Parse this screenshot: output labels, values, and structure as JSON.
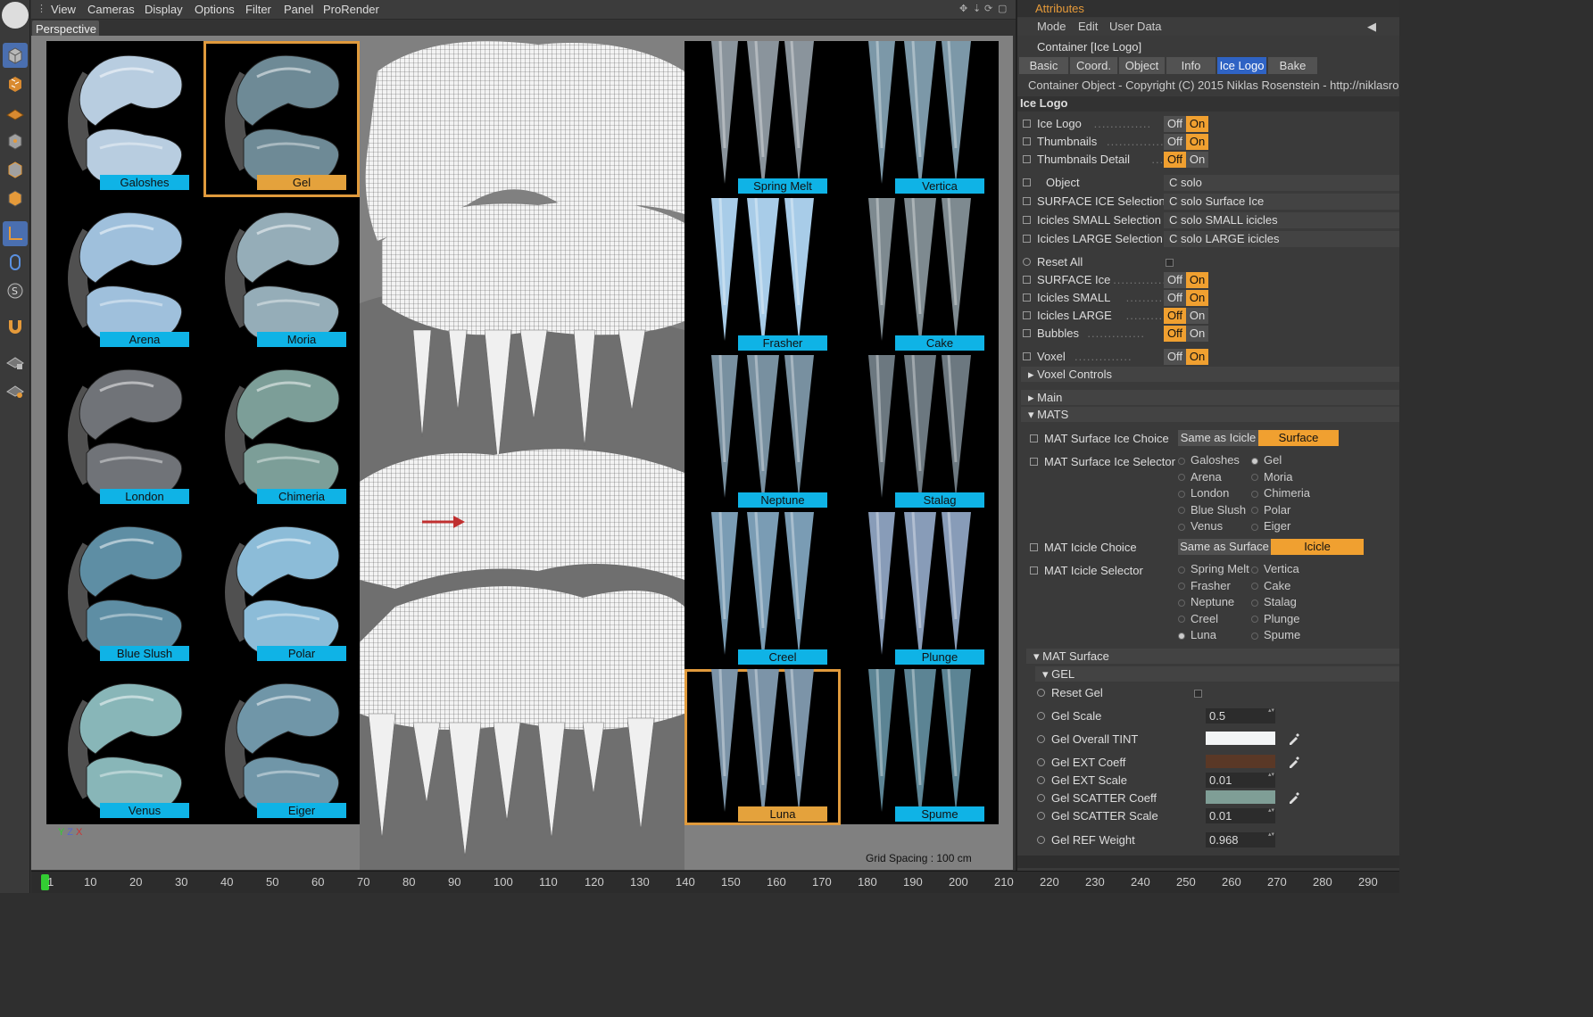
{
  "menubar": {
    "items": [
      "View",
      "Cameras",
      "Display",
      "Options",
      "Filter",
      "Panel",
      "ProRender"
    ]
  },
  "viewport": {
    "label": "Perspective",
    "grid_spacing": "Grid Spacing : 100 cm",
    "axis_labels": {
      "y": "Y",
      "z": "Z",
      "x": "X"
    }
  },
  "surface_thumbs": [
    {
      "label": "Galoshes",
      "selected": false,
      "color": "#b8cde0"
    },
    {
      "label": "Gel",
      "selected": true,
      "color": "#6e8a96"
    },
    {
      "label": "Arena",
      "selected": false,
      "color": "#9fc0dc"
    },
    {
      "label": "Moria",
      "selected": false,
      "color": "#95adb8"
    },
    {
      "label": "London",
      "selected": false,
      "color": "#707378"
    },
    {
      "label": "Chimeria",
      "selected": false,
      "color": "#7c9e98"
    },
    {
      "label": "Blue Slush",
      "selected": false,
      "color": "#5e8ea4"
    },
    {
      "label": "Polar",
      "selected": false,
      "color": "#8cbcd8"
    },
    {
      "label": "Venus",
      "selected": false,
      "color": "#88b6b8"
    },
    {
      "label": "Eiger",
      "selected": false,
      "color": "#7096a8"
    }
  ],
  "icicle_thumbs": [
    {
      "label": "Spring Melt",
      "selected": false,
      "color": "#8a949c"
    },
    {
      "label": "Vertica",
      "selected": false,
      "color": "#7c98a8"
    },
    {
      "label": "Frasher",
      "selected": false,
      "color": "#a8cce8"
    },
    {
      "label": "Cake",
      "selected": false,
      "color": "#7e8a90"
    },
    {
      "label": "Neptune",
      "selected": false,
      "color": "#7890a0"
    },
    {
      "label": "Stalag",
      "selected": false,
      "color": "#6c7880"
    },
    {
      "label": "Creel",
      "selected": false,
      "color": "#7a9cb4"
    },
    {
      "label": "Plunge",
      "selected": false,
      "color": "#889cb8"
    },
    {
      "label": "Luna",
      "selected": true,
      "color": "#7c94a8"
    },
    {
      "label": "Spume",
      "selected": false,
      "color": "#5c8494"
    }
  ],
  "timeline": {
    "ticks": [
      "1",
      "10",
      "20",
      "30",
      "40",
      "50",
      "60",
      "70",
      "80",
      "90",
      "100",
      "110",
      "120",
      "130",
      "140",
      "150",
      "160",
      "170",
      "180",
      "190",
      "200",
      "210",
      "220",
      "230",
      "240",
      "250",
      "260",
      "270",
      "280",
      "290"
    ],
    "marker_color": "#33cc33"
  },
  "attributes": {
    "title": "Attributes",
    "menu": [
      "Mode",
      "Edit",
      "User Data"
    ],
    "container": "Container [Ice Logo]",
    "tabs": [
      {
        "label": "Basic",
        "active": false
      },
      {
        "label": "Coord.",
        "active": false
      },
      {
        "label": "Object",
        "active": false
      },
      {
        "label": "Info",
        "active": false
      },
      {
        "label": "Ice Logo",
        "active": true
      },
      {
        "label": "Bake",
        "active": false
      }
    ],
    "copyright": "Container Object - Copyright (C) 2015 Niklas Rosenstein - http://niklasro",
    "section": "Ice Logo",
    "toggles1": [
      {
        "label": "Ice Logo",
        "state": "On"
      },
      {
        "label": "Thumbnails",
        "state": "On"
      },
      {
        "label": "Thumbnails Detail",
        "state": "Off"
      }
    ],
    "links": [
      {
        "label": "Object",
        "value": "C solo"
      },
      {
        "label": "SURFACE ICE Selection",
        "value": "C solo Surface Ice"
      },
      {
        "label": "Icicles SMALL Selection",
        "value": "C solo SMALL icicles"
      },
      {
        "label": "Icicles LARGE Selection",
        "value": "C solo LARGE icicles"
      }
    ],
    "reset_all": "Reset All",
    "toggles2": [
      {
        "label": "SURFACE Ice",
        "state": "On"
      },
      {
        "label": "Icicles SMALL",
        "state": "On"
      },
      {
        "label": "Icicles LARGE",
        "state": "Off"
      },
      {
        "label": "Bubbles",
        "state": "Off"
      }
    ],
    "voxel": {
      "label": "Voxel",
      "state": "On"
    },
    "off": "Off",
    "on": "On",
    "groups": {
      "voxel_controls": "Voxel Controls",
      "main": "Main",
      "mats": "MATS"
    },
    "surface_choice": {
      "label": "MAT Surface Ice Choice",
      "options": [
        "Same as Icicle",
        "Surface"
      ],
      "selected": "Surface"
    },
    "surface_selector": {
      "label": "MAT Surface Ice Selector",
      "col1": [
        "Galoshes",
        "Arena",
        "London",
        "Blue Slush",
        "Venus"
      ],
      "col2": [
        "Gel",
        "Moria",
        "Chimeria",
        "Polar",
        "Eiger"
      ],
      "selected": "Gel"
    },
    "icicle_choice": {
      "label": "MAT Icicle Choice",
      "options": [
        "Same as Surface",
        "Icicle"
      ],
      "selected": "Icicle"
    },
    "icicle_selector": {
      "label": "MAT Icicle Selector",
      "col1": [
        "Spring Melt",
        "Frasher",
        "Neptune",
        "Creel",
        "Luna"
      ],
      "col2": [
        "Vertica",
        "Cake",
        "Stalag",
        "Plunge",
        "Spume"
      ],
      "selected": "Luna"
    },
    "mat_surface": "MAT Surface",
    "gel": "GEL",
    "reset_gel": "Reset Gel",
    "gel_params": [
      {
        "label": "Gel Scale",
        "type": "num",
        "value": "0.5"
      },
      {
        "label": "Gel Overall TINT",
        "type": "color",
        "value": "#f2f4f5"
      },
      {
        "label": "Gel EXT Coeff",
        "type": "color",
        "value": "#5a3826"
      },
      {
        "label": "Gel EXT Scale",
        "type": "num",
        "value": "0.01"
      },
      {
        "label": "Gel SCATTER Coeff",
        "type": "color",
        "value": "#7f9e96"
      },
      {
        "label": "Gel SCATTER Scale",
        "type": "num",
        "value": "0.01"
      },
      {
        "label": "Gel REF Weight",
        "type": "num",
        "value": "0.968"
      }
    ]
  }
}
